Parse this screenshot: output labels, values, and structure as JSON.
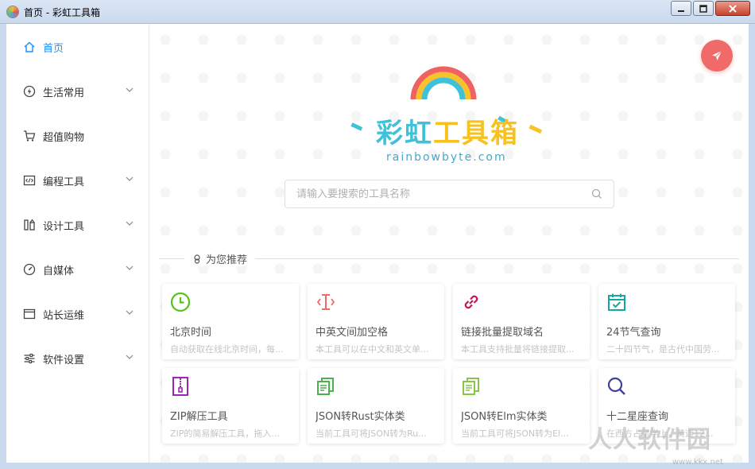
{
  "window": {
    "title": "首页 - 彩虹工具箱"
  },
  "sidebar": {
    "items": [
      {
        "label": "首页",
        "icon": "home-icon",
        "active": true
      },
      {
        "label": "生活常用",
        "icon": "lightning-icon",
        "expandable": true
      },
      {
        "label": "超值购物",
        "icon": "cart-icon",
        "expandable": false
      },
      {
        "label": "编程工具",
        "icon": "code-icon",
        "expandable": true
      },
      {
        "label": "设计工具",
        "icon": "design-icon",
        "expandable": true
      },
      {
        "label": "自媒体",
        "icon": "gauge-icon",
        "expandable": true
      },
      {
        "label": "站长运维",
        "icon": "window-icon",
        "expandable": true
      },
      {
        "label": "软件设置",
        "icon": "sliders-icon",
        "expandable": true
      }
    ]
  },
  "logo": {
    "title_part1": "彩虹",
    "title_part2": "工具箱",
    "subtitle": "rainbowbyte.com"
  },
  "search": {
    "placeholder": "请输入要搜索的工具名称"
  },
  "recommend": {
    "label": "为您推荐"
  },
  "cards": [
    {
      "name": "北京时间",
      "desc": "自动获取在线北京时间，每...",
      "icon": "clock-icon",
      "color": "#52c41a"
    },
    {
      "name": "中英文间加空格",
      "desc": "本工具可以在中文和英文单...",
      "icon": "text-cursor-icon",
      "color": "#f06a6a"
    },
    {
      "name": "链接批量提取域名",
      "desc": "本工具支持批量将链接提取...",
      "icon": "link-icon",
      "color": "#c2185b"
    },
    {
      "name": "24节气查询",
      "desc": "二十四节气，是古代中国劳...",
      "icon": "calendar-check-icon",
      "color": "#13a89e"
    },
    {
      "name": "ZIP解压工具",
      "desc": "ZIP的简易解压工具，拖入...",
      "icon": "zip-file-icon",
      "color": "#9c27b0"
    },
    {
      "name": "JSON转Rust实体类",
      "desc": "当前工具可将JSON转为Ru...",
      "icon": "copy-icon",
      "color": "#4caf50"
    },
    {
      "name": "JSON转Elm实体类",
      "desc": "当前工具可将JSON转为El...",
      "icon": "copy-icon",
      "color": "#8bc34a"
    },
    {
      "name": "十二星座查询",
      "desc": "在西方占星学上，黄道12...",
      "icon": "search-icon",
      "color": "#3f3f9f"
    }
  ],
  "watermark": {
    "text": "人人软件园",
    "url": "www.kkx.net"
  }
}
